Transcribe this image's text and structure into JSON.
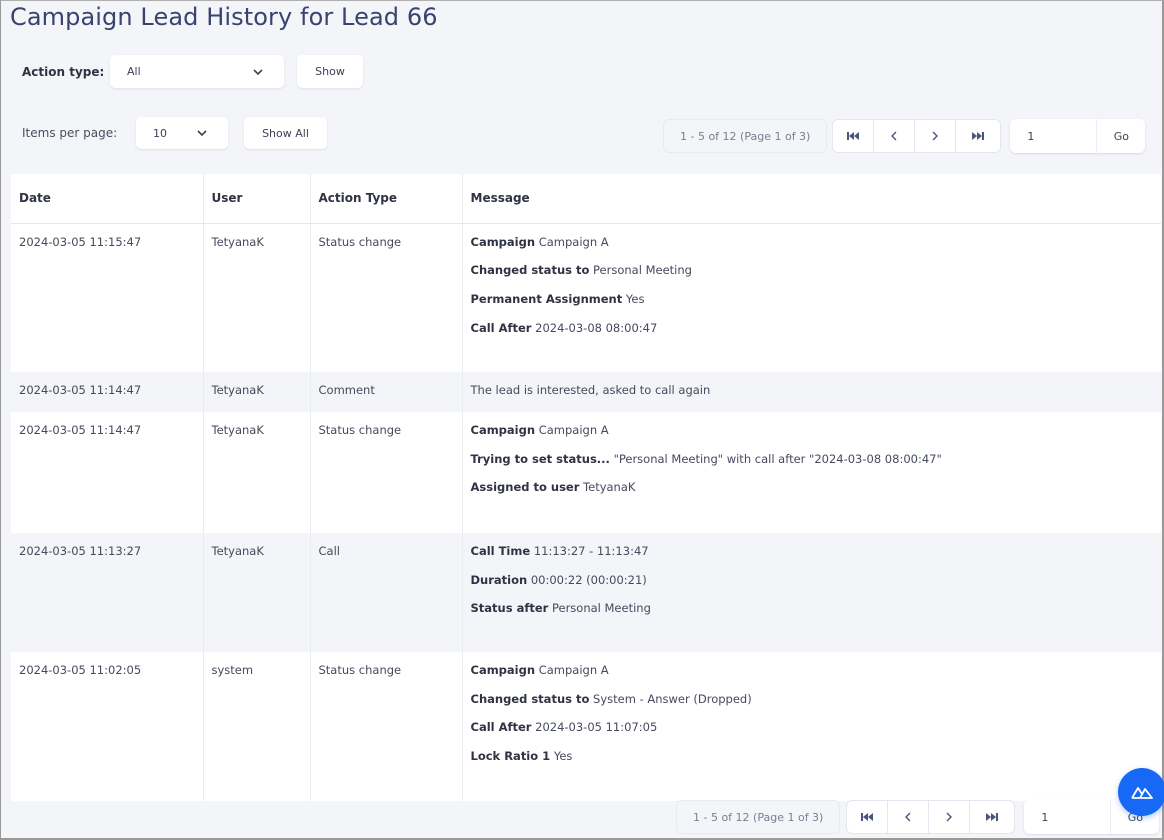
{
  "page": {
    "title": "Campaign Lead History for Lead 66"
  },
  "filters": {
    "action_type_label": "Action type:",
    "action_type_value": "All",
    "show_button": "Show",
    "items_per_page_label": "Items per page:",
    "items_per_page_value": "10",
    "show_all_button": "Show All"
  },
  "pagination": {
    "info": "1 - 5 of 12 (Page 1 of 3)",
    "first_icon": "first-page-icon",
    "prev_icon": "prev-page-icon",
    "next_icon": "next-page-icon",
    "last_icon": "last-page-icon",
    "page_input_value": "1",
    "go_button": "Go"
  },
  "table": {
    "columns": [
      "Date",
      "User",
      "Action Type",
      "Message"
    ],
    "rows": [
      {
        "date": "2024-03-05 11:15:47",
        "user": "TetyanaK",
        "action_type": "Status change",
        "message": [
          {
            "label": "Campaign",
            "value": "Campaign A"
          },
          {
            "label": "Changed status to",
            "value": "Personal Meeting"
          },
          {
            "label": "Permanent Assignment",
            "value": "Yes"
          },
          {
            "label": "Call After",
            "value": "2024-03-08 08:00:47"
          }
        ]
      },
      {
        "date": "2024-03-05 11:14:47",
        "user": "TetyanaK",
        "action_type": "Comment",
        "message": [
          {
            "label": "",
            "value": "The lead is interested, asked to call again"
          }
        ]
      },
      {
        "date": "2024-03-05 11:14:47",
        "user": "TetyanaK",
        "action_type": "Status change",
        "message": [
          {
            "label": "Campaign",
            "value": "Campaign A"
          },
          {
            "label": "Trying to set status...",
            "value": "\"Personal Meeting\" with call after \"2024-03-08 08:00:47\""
          },
          {
            "label": "Assigned to user",
            "value": "TetyanaK"
          }
        ]
      },
      {
        "date": "2024-03-05 11:13:27",
        "user": "TetyanaK",
        "action_type": "Call",
        "message": [
          {
            "label": "Call Time",
            "value": "11:13:27 - 11:13:47"
          },
          {
            "label": "Duration",
            "value": "00:00:22 (00:00:21)"
          },
          {
            "label": "Status after",
            "value": "Personal Meeting"
          }
        ]
      },
      {
        "date": "2024-03-05 11:02:05",
        "user": "system",
        "action_type": "Status change",
        "message": [
          {
            "label": "Campaign",
            "value": "Campaign A"
          },
          {
            "label": "Changed status to",
            "value": "System - Answer (Dropped)"
          },
          {
            "label": "Call After",
            "value": "2024-03-05 11:07:05"
          },
          {
            "label": "Lock Ratio 1",
            "value": "Yes"
          }
        ]
      }
    ]
  },
  "fab": {
    "icon": "mountains-icon",
    "color": "#1769f5"
  }
}
